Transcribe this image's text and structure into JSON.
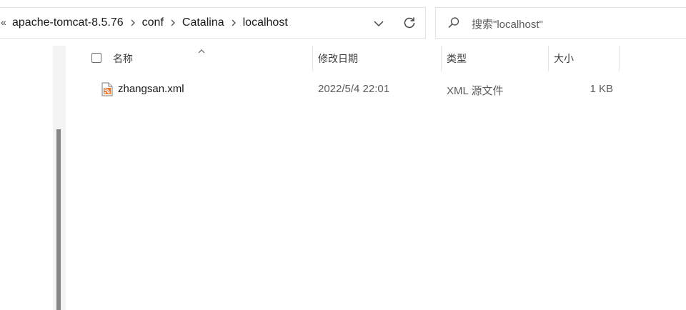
{
  "address_bar": {
    "overflow": "«",
    "breadcrumbs": [
      "apache-tomcat-8.5.76",
      "conf",
      "Catalina",
      "localhost"
    ]
  },
  "search": {
    "placeholder": "搜索\"localhost\""
  },
  "columns": {
    "name": "名称",
    "date_modified": "修改日期",
    "type": "类型",
    "size": "大小"
  },
  "files": [
    {
      "name": "zhangsan.xml",
      "date_modified": "2022/5/4 22:01",
      "type": "XML 源文件",
      "size": "1 KB",
      "icon": "xml-file-icon"
    }
  ],
  "colors": {
    "border": "#e3e3e3",
    "scroll_thumb": "#868686",
    "xml_icon_accent": "#e8742a"
  }
}
